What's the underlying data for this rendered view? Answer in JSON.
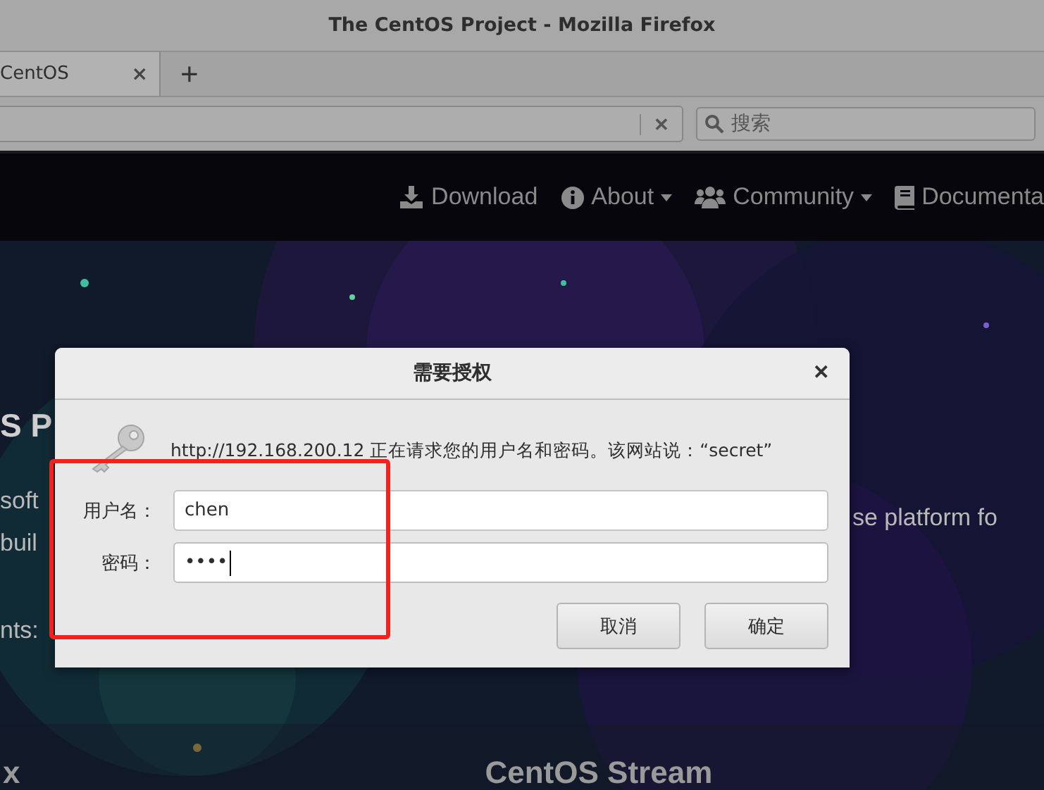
{
  "window": {
    "title": "The CentOS Project - Mozilla Firefox"
  },
  "tabs": [
    {
      "label": "CentOS",
      "selected": true,
      "close": "×"
    }
  ],
  "address_clear": "✕",
  "new_tab": "+",
  "search": {
    "placeholder": "搜索"
  },
  "site_nav": [
    {
      "label": "Download",
      "kind": "download",
      "caret": false
    },
    {
      "label": "About",
      "kind": "info",
      "caret": true
    },
    {
      "label": "Community",
      "kind": "users",
      "caret": true
    },
    {
      "label": "Documenta",
      "kind": "book",
      "caret": false
    }
  ],
  "page": {
    "heading": "S P",
    "left_lines": [
      "soft",
      "buil"
    ],
    "right_line": "se platform fo",
    "last_line": "nts:",
    "bottom_left": "x",
    "bottom_heading": "CentOS Stream"
  },
  "dialog": {
    "title": "需要授权",
    "close": "✕",
    "message": "http://192.168.200.12 正在请求您的用户名和密码。该网站说：“secret”",
    "fields": [
      {
        "label": "用户名：",
        "value": "chen",
        "focused": false
      },
      {
        "label": "密码：",
        "value": "••••",
        "focused": true
      }
    ],
    "buttons": [
      {
        "label": "取消"
      },
      {
        "label": "确定"
      }
    ]
  }
}
